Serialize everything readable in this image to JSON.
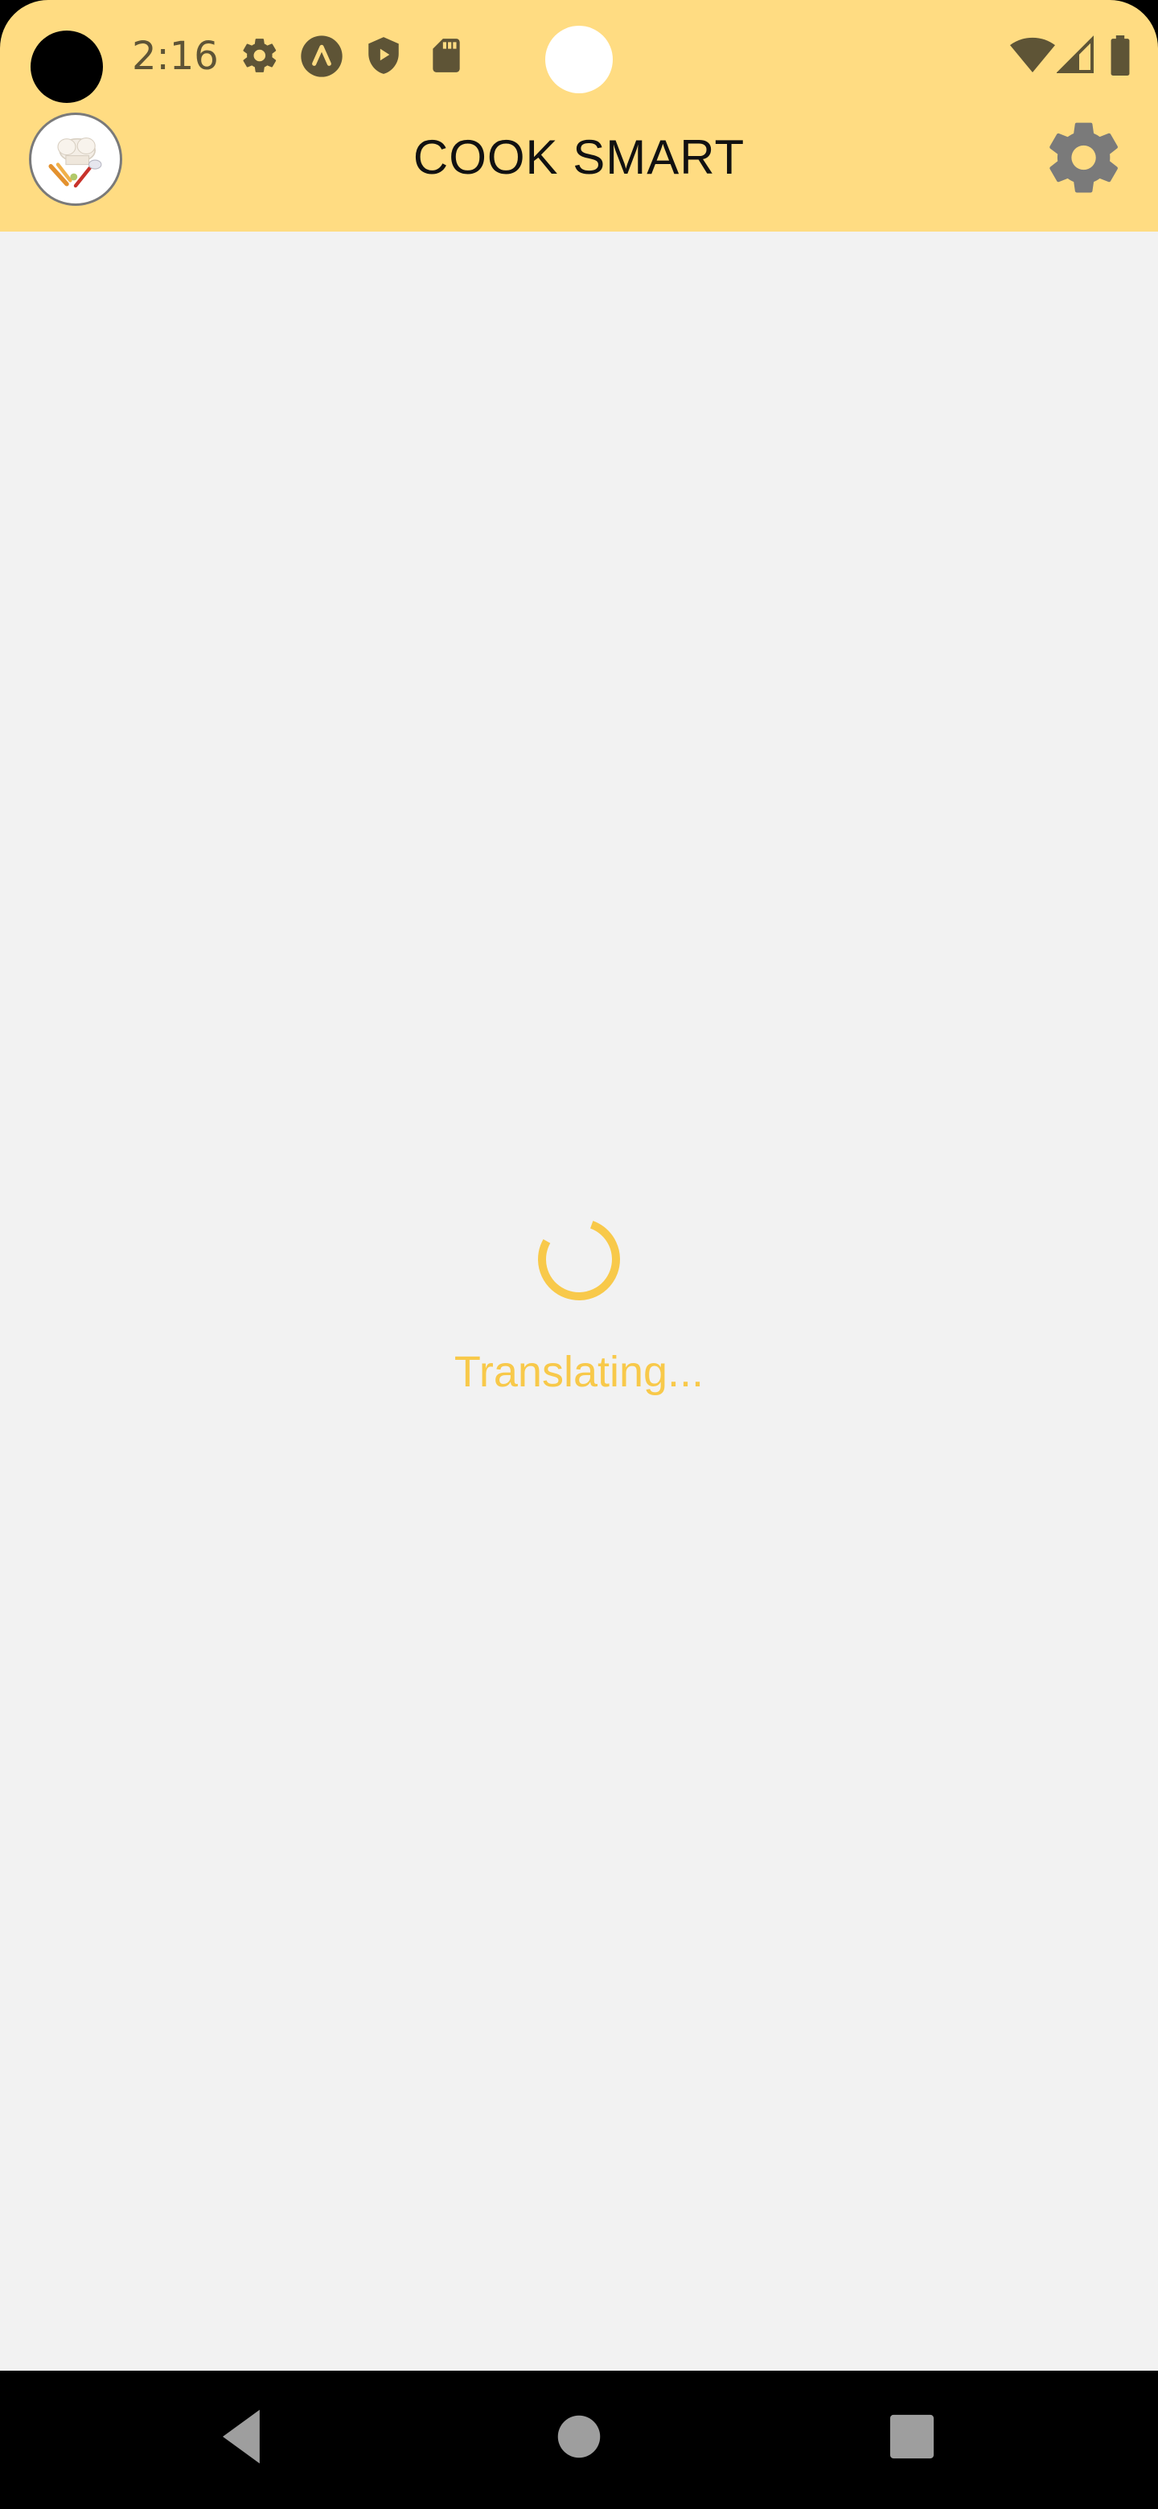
{
  "status_bar": {
    "time": "2:16",
    "icons": [
      "settings-icon",
      "assistant-icon",
      "shield-play-icon",
      "sd-card-icon"
    ],
    "right_icons": [
      "wifi-icon",
      "signal-icon",
      "battery-icon"
    ]
  },
  "app_bar": {
    "title": "COOK SMART",
    "logo": "chef-logo",
    "settings_icon": "gear-icon"
  },
  "main": {
    "loading_text": "Translating..."
  },
  "nav_bar": {
    "buttons": [
      "back-icon",
      "home-icon",
      "recents-icon"
    ]
  },
  "colors": {
    "header_bg": "#FFDC82",
    "content_bg": "#F2F2F2",
    "accent": "#F8C94A",
    "gear": "#7A7A7A",
    "nav_bg": "#000000"
  }
}
